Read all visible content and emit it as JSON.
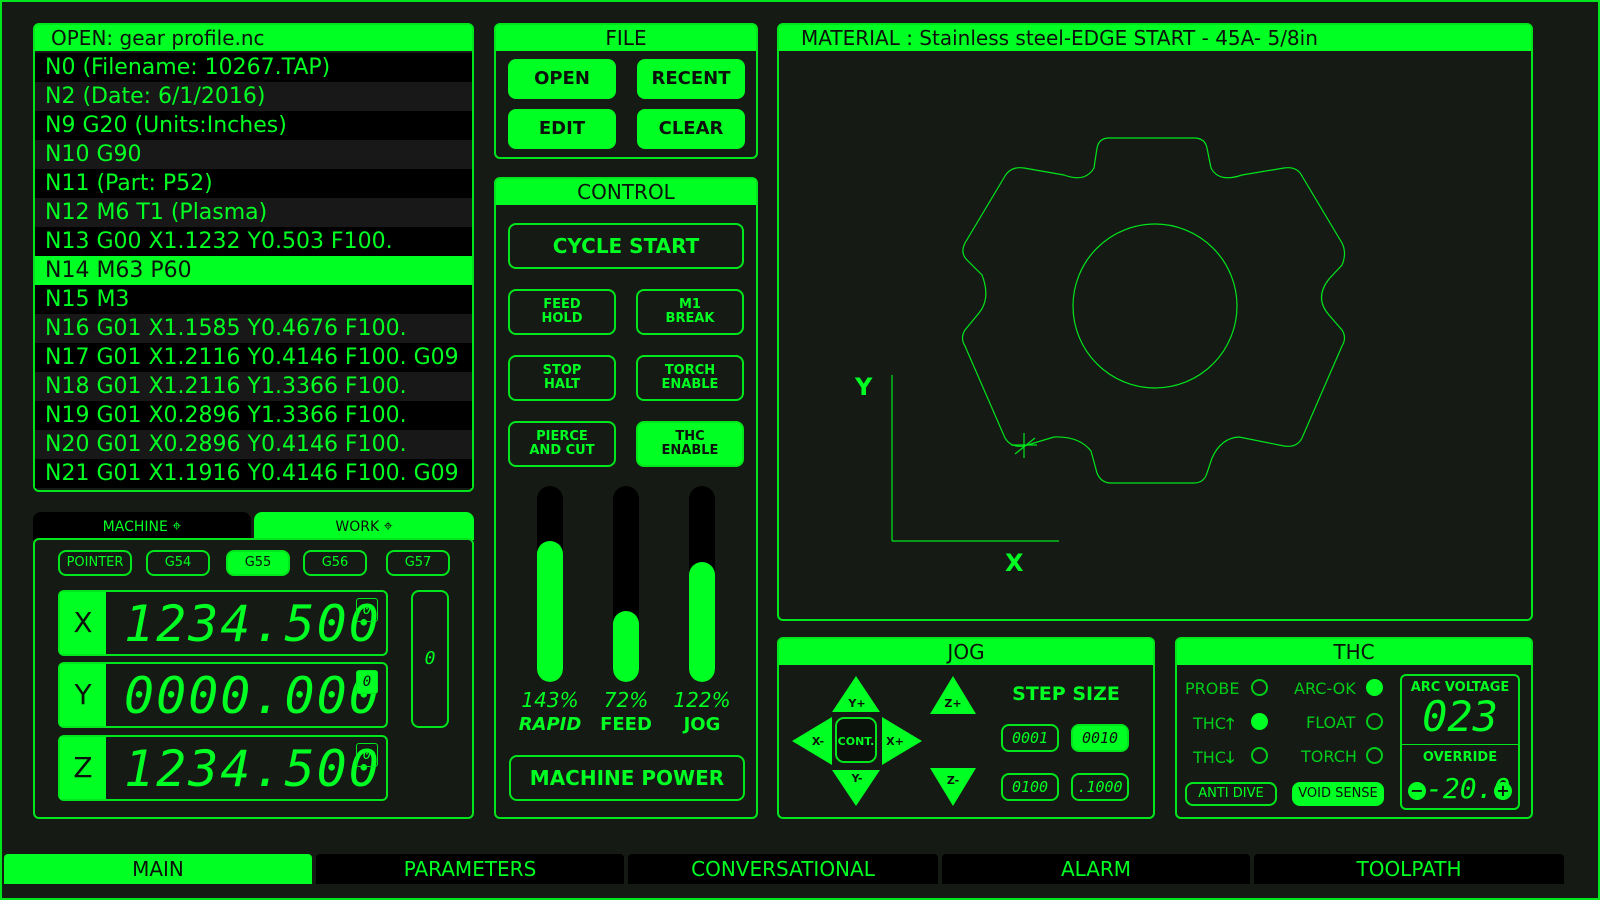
{
  "program": {
    "header": "OPEN: gear profile.nc",
    "lines": [
      "N0 (Filename: 10267.TAP)",
      "N2 (Date: 6/1/2016)",
      "N9 G20 (Units:Inches)",
      "N10 G90",
      "N11 (Part: P52)",
      "N12 M6 T1 (Plasma)",
      "N13 G00 X1.1232 Y0.503 F100.",
      "N14 M63 P60",
      "N15 M3",
      "N16 G01 X1.1585 Y0.4676 F100.",
      "N17 G01 X1.2116 Y0.4146 F100. G09",
      "N18 G01 X1.2116 Y1.3366 F100.",
      "N19 G01 X0.2896 Y1.3366 F100.",
      "N20 G01 X0.2896 Y0.4146 F100.",
      "N21 G01 X1.1916 Y0.4146 F100. G09"
    ],
    "active_index": 7
  },
  "file": {
    "title": "FILE",
    "open": "OPEN",
    "recent": "RECENT",
    "edit": "EDIT",
    "clear": "CLEAR"
  },
  "control": {
    "title": "CONTROL",
    "cycle_start": "CYCLE START",
    "feed_hold": "FEED\nHOLD",
    "m1_break": "M1\nBREAK",
    "stop_halt": "STOP\nHALT",
    "torch_enable": "TORCH\nENABLE",
    "pierce_cut": "PIERCE\nAND CUT",
    "thc_enable": "THC\nENABLE",
    "machine_power": "MACHINE POWER"
  },
  "overrides": [
    {
      "pct": "143%",
      "label": "RAPID",
      "level": 0.72
    },
    {
      "pct": "72%",
      "label": "FEED",
      "level": 0.36
    },
    {
      "pct": "122%",
      "label": "JOG",
      "level": 0.61
    }
  ],
  "toolpath": {
    "material": "MATERIAL : Stainless steel-EDGE START - 45A- 5/8in",
    "y_label": "Y",
    "x_label": "X"
  },
  "coords": {
    "tab_machine": "MACHINE",
    "tab_work": "WORK",
    "offsets": [
      "POINTER",
      "G54",
      "G55",
      "G56",
      "G57"
    ],
    "selected_offset": "G55",
    "axes": [
      {
        "letter": "X",
        "value": "1234.500",
        "zero": "0"
      },
      {
        "letter": "Y",
        "value": "0000.000",
        "zero": "0"
      },
      {
        "letter": "Z",
        "value": "1234.500",
        "zero": "0"
      }
    ],
    "side_value": "0"
  },
  "jog": {
    "title": "JOG",
    "y_plus": "Y+",
    "y_minus": "Y-",
    "x_plus": "X+",
    "x_minus": "X-",
    "cont": "CONT.",
    "z_plus": "Z+",
    "z_minus": "Z-",
    "step_title": "STEP SIZE",
    "steps": [
      "0001",
      "0010",
      "0100",
      ".1000"
    ],
    "selected_step": "0010"
  },
  "thc": {
    "title": "THC",
    "probe": "PROBE",
    "arc_ok": "ARC-OK",
    "thc_up": "THC",
    "float": "FLOAT",
    "thc_down": "THC",
    "torch": "TORCH",
    "anti_dive": "ANTI DIVE",
    "void_sense": "VOID SENSE",
    "arc_voltage_label": "ARC VOLTAGE",
    "arc_voltage": "023",
    "override_label": "OVERRIDE",
    "override_value": "-20.0"
  },
  "tabs": [
    "MAIN",
    "PARAMETERS",
    "CONVERSATIONAL",
    "ALARM",
    "TOOLPATH"
  ],
  "active_tab": "MAIN"
}
